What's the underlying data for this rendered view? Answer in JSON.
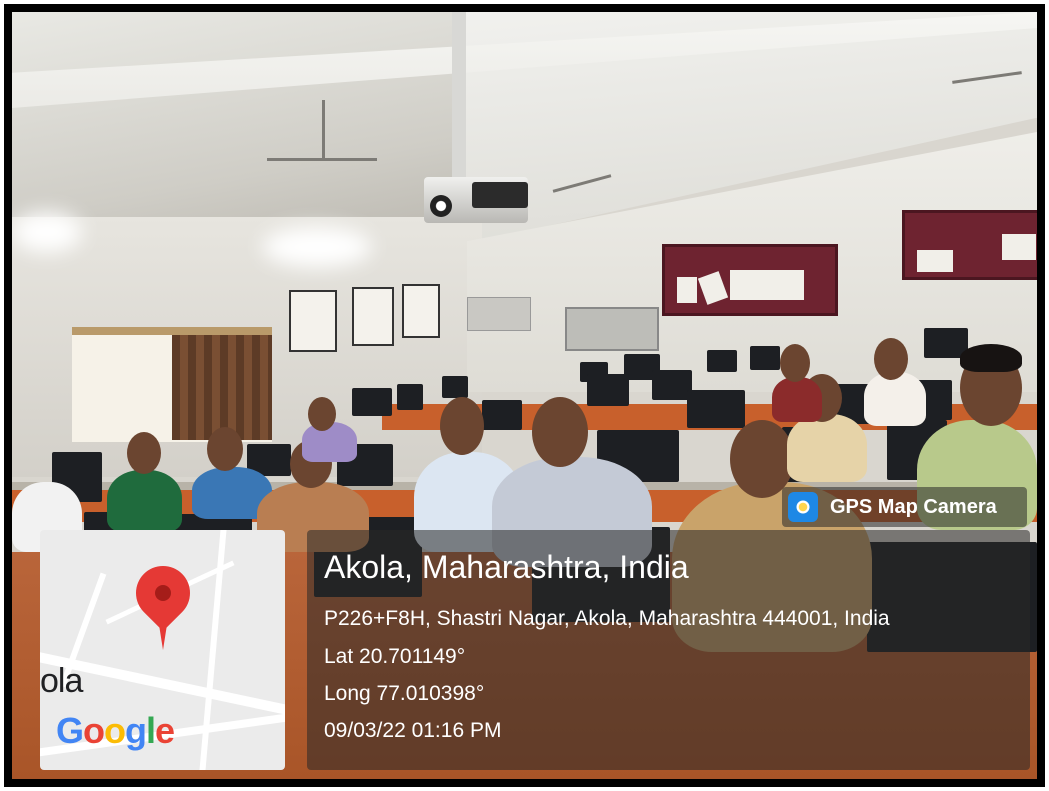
{
  "overlay": {
    "brand": {
      "icon": "camera-pin-icon",
      "name": "GPS Map Camera"
    },
    "place_title": "Akola, Maharashtra, India",
    "address": "P226+F8H, Shastri Nagar, Akola, Maharashtra 444001, India",
    "latitude": "Lat 20.701149°",
    "longitude": "Long 77.010398°",
    "datetime": "09/03/22 01:16 PM"
  },
  "map": {
    "place_fragment": "ola",
    "logo_letters": [
      "G",
      "o",
      "o",
      "g",
      "l",
      "e"
    ],
    "pin_icon": "map-pin-icon"
  },
  "colors": {
    "pin": "#e53935",
    "panel": "rgba(40,40,40,0.55)",
    "desk": "#c8602c"
  }
}
